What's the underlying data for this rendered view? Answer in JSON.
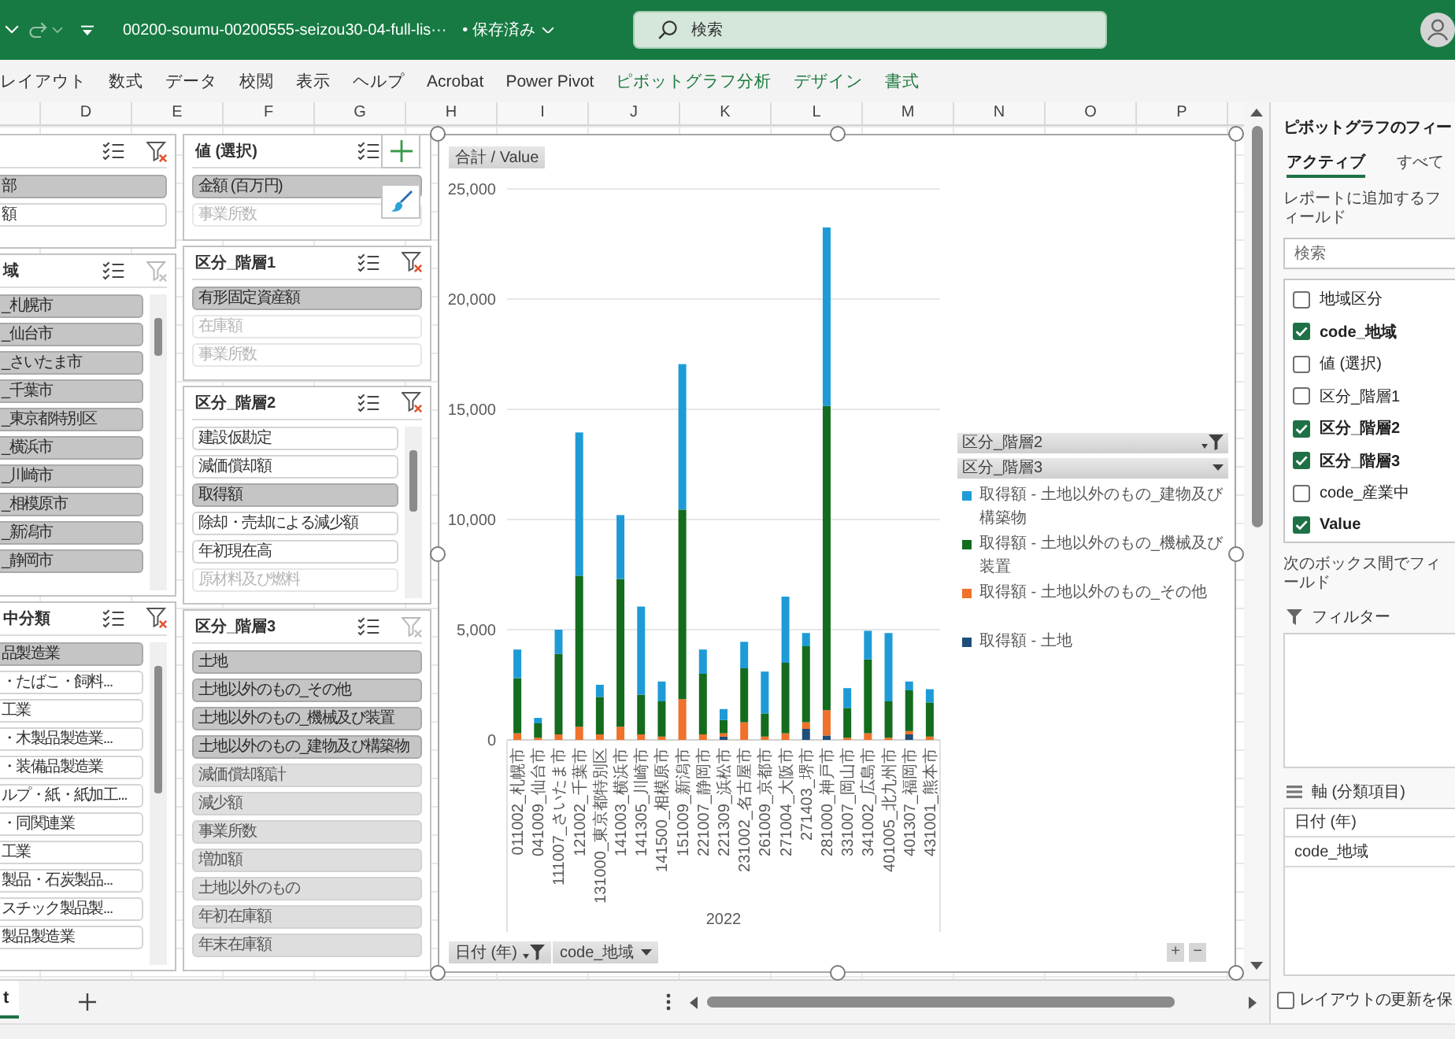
{
  "title_bar": {
    "filename": "00200-soumu-00200555-seizou30-04-full-lis···",
    "save_status": "• 保存済み",
    "search": {
      "placeholder": "検索"
    }
  },
  "ribbon_tabs": [
    {
      "label": "レイアウト",
      "kind": "standard"
    },
    {
      "label": "数式",
      "kind": "standard"
    },
    {
      "label": "データ",
      "kind": "standard"
    },
    {
      "label": "校閲",
      "kind": "standard"
    },
    {
      "label": "表示",
      "kind": "standard"
    },
    {
      "label": "ヘルプ",
      "kind": "standard"
    },
    {
      "label": "Acrobat",
      "kind": "standard"
    },
    {
      "label": "Power Pivot",
      "kind": "standard"
    },
    {
      "label": "ピボットグラフ分析",
      "kind": "contextual"
    },
    {
      "label": "デザイン",
      "kind": "contextual"
    },
    {
      "label": "書式",
      "kind": "contextual"
    }
  ],
  "column_headers": [
    "D",
    "E",
    "F",
    "G",
    "H",
    "I",
    "J",
    "K",
    "L",
    "M",
    "N",
    "O",
    "P"
  ],
  "slicer_columns": [
    {
      "slicers": [
        {
          "filtered": true,
          "scrollable": false,
          "items": [
            {
              "label": "部",
              "selected": true,
              "disabled": false
            },
            {
              "label": "額",
              "selected": false,
              "disabled": false
            }
          ]
        },
        {
          "title": "域",
          "filtered": false,
          "scrollable": true,
          "items": [
            {
              "label": "_札幌市",
              "selected": true,
              "disabled": false
            },
            {
              "label": "_仙台市",
              "selected": true,
              "disabled": false
            },
            {
              "label": "_さいたま市",
              "selected": true,
              "disabled": false
            },
            {
              "label": "_千葉市",
              "selected": true,
              "disabled": false
            },
            {
              "label": "_東京都特別区",
              "selected": true,
              "disabled": false
            },
            {
              "label": "_横浜市",
              "selected": true,
              "disabled": false
            },
            {
              "label": "_川崎市",
              "selected": true,
              "disabled": false
            },
            {
              "label": "_相模原市",
              "selected": true,
              "disabled": false
            },
            {
              "label": "_新潟市",
              "selected": true,
              "disabled": false
            },
            {
              "label": "_静岡市",
              "selected": true,
              "disabled": false
            }
          ]
        },
        {
          "title": "中分類",
          "filtered": true,
          "scrollable": true,
          "items": [
            {
              "label": "品製造業",
              "selected": true,
              "disabled": false
            },
            {
              "label": "・たばこ・飼料...",
              "selected": false,
              "disabled": false
            },
            {
              "label": "工業",
              "selected": false,
              "disabled": false
            },
            {
              "label": "・木製品製造業...",
              "selected": false,
              "disabled": false
            },
            {
              "label": "・装備品製造業",
              "selected": false,
              "disabled": false
            },
            {
              "label": "ルプ・紙・紙加工...",
              "selected": false,
              "disabled": false
            },
            {
              "label": "・同関連業",
              "selected": false,
              "disabled": false
            },
            {
              "label": "工業",
              "selected": false,
              "disabled": false
            },
            {
              "label": "製品・石炭製品...",
              "selected": false,
              "disabled": false
            },
            {
              "label": "スチック製品製...",
              "selected": false,
              "disabled": false
            },
            {
              "label": "製品製造業",
              "selected": false,
              "disabled": false
            }
          ]
        }
      ]
    },
    {
      "slicers": [
        {
          "title": "値 (選択)",
          "scrollable": false,
          "items": [
            {
              "label": "金額 (百万円)",
              "selected": true,
              "disabled": false
            },
            {
              "label": "事業所数",
              "selected": false,
              "disabled": true
            }
          ]
        },
        {
          "title": "区分_階層1",
          "filtered": true,
          "scrollable": false,
          "items": [
            {
              "label": "有形固定資産額",
              "selected": true,
              "disabled": false
            },
            {
              "label": "在庫額",
              "selected": false,
              "disabled": true
            },
            {
              "label": "事業所数",
              "selected": false,
              "disabled": true
            }
          ]
        },
        {
          "title": "区分_階層2",
          "filtered": true,
          "scrollable": true,
          "items": [
            {
              "label": "建設仮勘定",
              "selected": false,
              "disabled": false
            },
            {
              "label": "減価償却額",
              "selected": false,
              "disabled": false
            },
            {
              "label": "取得額",
              "selected": true,
              "disabled": false
            },
            {
              "label": "除却・売却による減少額",
              "selected": false,
              "disabled": false
            },
            {
              "label": "年初現在高",
              "selected": false,
              "disabled": false
            },
            {
              "label": "原材料及び燃料",
              "selected": false,
              "disabled": true
            }
          ]
        },
        {
          "title": "区分_階層3",
          "filtered": false,
          "scrollable": false,
          "items": [
            {
              "label": "土地",
              "selected": true,
              "disabled": false
            },
            {
              "label": "土地以外のもの_その他",
              "selected": true,
              "disabled": false
            },
            {
              "label": "土地以外のもの_機械及び装置",
              "selected": true,
              "disabled": false
            },
            {
              "label": "土地以外のもの_建物及び構築物",
              "selected": true,
              "disabled": false
            },
            {
              "label": "減価償却額計",
              "selected": true,
              "disabled": true
            },
            {
              "label": "減少額",
              "selected": true,
              "disabled": true
            },
            {
              "label": "事業所数",
              "selected": true,
              "disabled": true
            },
            {
              "label": "増加額",
              "selected": true,
              "disabled": true
            },
            {
              "label": "土地以外のもの",
              "selected": true,
              "disabled": true
            },
            {
              "label": "年初在庫額",
              "selected": true,
              "disabled": true
            },
            {
              "label": "年末在庫額",
              "selected": true,
              "disabled": true
            }
          ]
        }
      ]
    }
  ],
  "pivot_chart": {
    "value_field_button": "合計 / Value",
    "chart_data": {
      "type": "bar",
      "stacked": true,
      "grid": true,
      "xlabel": "2022",
      "categories": [
        "011002_札幌市",
        "041009_仙台市",
        "111007_さいたま市",
        "121002_千葉市",
        "131000_東京都特別区",
        "141003_横浜市",
        "141305_川崎市",
        "141500_相模原市",
        "151009_新潟市",
        "221007_静岡市",
        "221309_浜松市",
        "231002_名古屋市",
        "261009_京都市",
        "271004_大阪市",
        "271403_堺市",
        "281000_神戸市",
        "331007_岡山市",
        "341002_広島市",
        "401005_北九州市",
        "401307_福岡市",
        "431001_熊本市"
      ],
      "series": [
        {
          "name": "取得額 - 土地",
          "color": "#1f4e79",
          "values": [
            0,
            0,
            0,
            0,
            0,
            0,
            0,
            0,
            0,
            0,
            150,
            0,
            0,
            0,
            500,
            200,
            0,
            0,
            0,
            250,
            0
          ]
        },
        {
          "name": "取得額 - 土地以外のもの_その他",
          "color": "#f0712a",
          "values": [
            300,
            100,
            250,
            600,
            250,
            600,
            250,
            150,
            1850,
            250,
            150,
            800,
            150,
            300,
            300,
            1150,
            100,
            300,
            100,
            150,
            150
          ]
        },
        {
          "name": "取得額 - 土地以外のもの_機械及び装置",
          "color": "#146c1e",
          "values": [
            2500,
            650,
            3650,
            6850,
            1700,
            6700,
            1800,
            1600,
            8600,
            2750,
            600,
            2450,
            1050,
            3200,
            3450,
            13800,
            1350,
            3350,
            1650,
            1850,
            1550
          ]
        },
        {
          "name": "取得額 - 土地以外のもの_建物及び構築物",
          "color": "#1e9bd7",
          "values": [
            1300,
            250,
            1100,
            6500,
            550,
            2900,
            4000,
            900,
            6600,
            1100,
            500,
            1200,
            1900,
            3000,
            600,
            8100,
            900,
            1300,
            3100,
            400,
            600
          ]
        }
      ],
      "ylim": [
        0,
        25000
      ],
      "yticks": [
        {
          "value": 0,
          "label": "0"
        },
        {
          "value": 5000,
          "label": "5,000"
        },
        {
          "value": 10000,
          "label": "10,000"
        },
        {
          "value": 15000,
          "label": "15,000"
        },
        {
          "value": 20000,
          "label": "20,000"
        },
        {
          "value": 25000,
          "label": "25,000"
        }
      ]
    },
    "legend_field_buttons": [
      {
        "label": "区分_階層2",
        "filtered": true
      },
      {
        "label": "区分_階層3",
        "filtered": false
      }
    ],
    "axis_field_buttons": [
      {
        "label": "日付 (年)",
        "filtered": true
      },
      {
        "label": "code_地域",
        "filtered": false
      }
    ],
    "zoom_buttons": [
      "+",
      "−"
    ]
  },
  "sheet_tabs": [
    {
      "label": "t",
      "selected": true
    }
  ],
  "field_pane": {
    "title": "ピボットグラフのフィー",
    "tabs": [
      {
        "label": "アクティブ",
        "selected": true
      },
      {
        "label": "すべて",
        "selected": false
      }
    ],
    "description": "レポートに追加するフィールド",
    "search": {
      "placeholder": "検索"
    },
    "fields": [
      {
        "label": "地域区分",
        "checked": false
      },
      {
        "label": "code_地域",
        "checked": true
      },
      {
        "label": "値 (選択)",
        "checked": false
      },
      {
        "label": "区分_階層1",
        "checked": false
      },
      {
        "label": "区分_階層2",
        "checked": true
      },
      {
        "label": "区分_階層3",
        "checked": true
      },
      {
        "label": "code_産業中",
        "checked": false
      },
      {
        "label": "Value",
        "checked": true
      }
    ],
    "areas_hint": "次のボックス間でフィールド",
    "areas": [
      {
        "kind": "filters",
        "title": "フィルター"
      },
      {
        "kind": "axis",
        "title": "軸 (分類項目)",
        "items": [
          "日付 (年)",
          "code_地域"
        ]
      }
    ],
    "defer_update": {
      "label": "レイアウトの更新を保",
      "checked": false
    }
  }
}
